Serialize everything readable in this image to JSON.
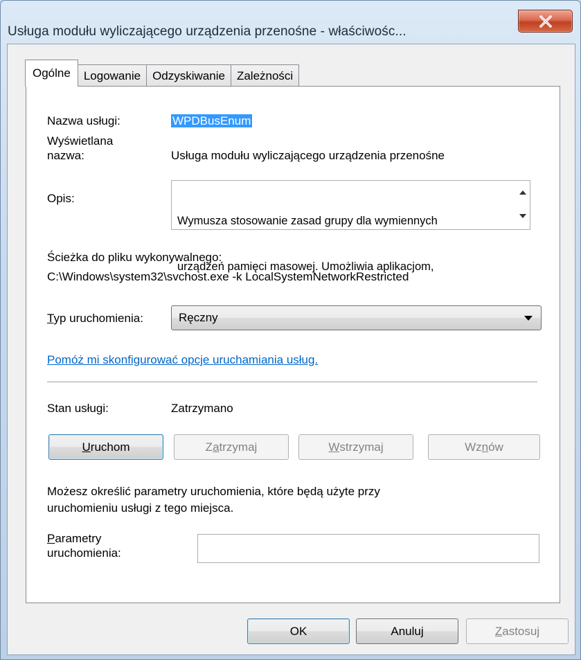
{
  "window": {
    "title": "Usługa modułu wyliczającego urządzenia przenośne - właściwośc...",
    "close_symbol": "X"
  },
  "tabs": [
    {
      "label": "Ogólne",
      "active": true
    },
    {
      "label": "Logowanie",
      "active": false
    },
    {
      "label": "Odzyskiwanie",
      "active": false
    },
    {
      "label": "Zależności",
      "active": false
    }
  ],
  "general": {
    "service_name_label": "Nazwa usługi:",
    "service_name_value": "WPDBusEnum",
    "display_name_label_line1": "Wyświetlana",
    "display_name_label_line2": "nazwa:",
    "display_name_value": "Usługa modułu wyliczającego urządzenia przenośne",
    "description_label": "Opis:",
    "description_line1": "Wymusza stosowanie zasad grupy dla wymiennych",
    "description_line2": "urządzeń pamięci masowej. Umożliwia aplikacjom,",
    "exe_path_label": "Ścieżka do pliku wykonywalnego:",
    "exe_path_value": "C:\\Windows\\system32\\svchost.exe -k LocalSystemNetworkRestricted",
    "startup_type_label_first": "T",
    "startup_type_label_rest": "yp uruchomienia:",
    "startup_type_value": "Ręczny",
    "help_link": "Pomóż mi skonfigurować opcje uruchamiania usług.",
    "status_label": "Stan usługi:",
    "status_value": "Zatrzymano",
    "start_params_note_line1": "Możesz określić parametry uruchomienia, które będą użyte przy",
    "start_params_note_line2": "uruchomieniu usługi z tego miejsca.",
    "start_params_label_first": "P",
    "start_params_label_rest": "arametry",
    "start_params_label_line2": "uruchomienia:",
    "start_params_value": ""
  },
  "service_buttons": {
    "start_a": "U",
    "start_b": "ruchom",
    "stop_a": "Z",
    "stop_b": "a",
    "stop_c": "trzymaj",
    "pause_a": "W",
    "pause_b": "strzymaj",
    "resume_a": "Wz",
    "resume_b": "n",
    "resume_c": "ów"
  },
  "dialog_buttons": {
    "ok": "OK",
    "cancel": "Anuluj",
    "apply_a": "Z",
    "apply_b": "astosuj"
  }
}
